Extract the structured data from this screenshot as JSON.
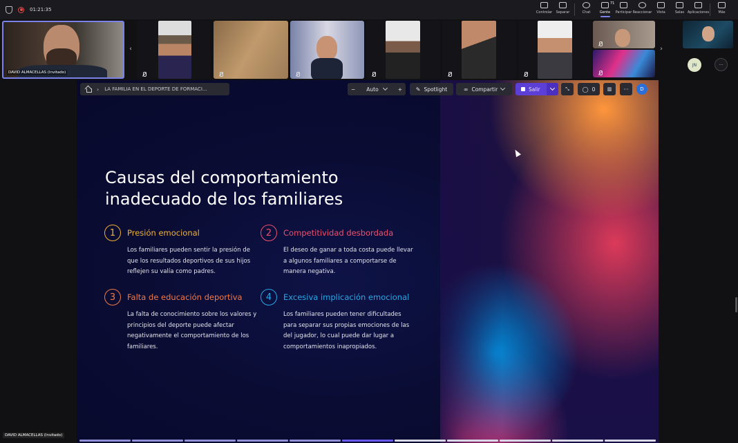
{
  "meeting": {
    "timer": "01:21:35",
    "toolbar": [
      {
        "label": "Controlar",
        "icon": "control-icon"
      },
      {
        "label": "Separar",
        "icon": "popout-icon"
      },
      {
        "label": "Chat",
        "icon": "chat-icon"
      },
      {
        "label": "Gente",
        "icon": "people-icon",
        "count": "71",
        "active": true
      },
      {
        "label": "Participar",
        "icon": "raise-hand-icon"
      },
      {
        "label": "Reaccionar",
        "icon": "smile-icon"
      },
      {
        "label": "Vista",
        "icon": "view-icon"
      },
      {
        "label": "Salas",
        "icon": "rooms-icon"
      },
      {
        "label": "Aplicaciones",
        "icon": "apps-icon"
      },
      {
        "label": "Más",
        "icon": "more-icon"
      }
    ],
    "self_tile_name": "DAVID ALMACELLAS (Invitado)",
    "bottom_name": "DAVID ALMACELLAS (Invitado)",
    "avatar_initials": "JN",
    "accent": "#7b83eb"
  },
  "presentation": {
    "breadcrumb": "LA FAMILIA EN EL DEPORTE DE FORMACI...",
    "zoom_label": "Auto",
    "zoom_minus": "−",
    "zoom_plus": "+",
    "spotlight_label": "Spotlight",
    "share_label": "Compartir",
    "exit_label": "Salir",
    "comment_count": "0",
    "user_initial": "D",
    "slide": {
      "title": "Causas del comportamiento inadecuado de los familiares",
      "items": [
        {
          "num": "1",
          "color": "#f2b233",
          "title": "Presión emocional",
          "desc": "Los familiares pueden sentir la presión de que los resultados deportivos de sus hijos reflejen su valía como padres."
        },
        {
          "num": "2",
          "color": "#ef4f6c",
          "title": "Competitividad desbordada",
          "desc": "El deseo de ganar a toda costa puede llevar a algunos familiares a comportarse de manera negativa."
        },
        {
          "num": "3",
          "color": "#f2794a",
          "title": "Falta de educación deportiva",
          "desc": "La falta de conocimiento sobre los valores y principios del deporte puede afectar negativamente el comportamiento de los familiares."
        },
        {
          "num": "4",
          "color": "#27a8e6",
          "title": "Excesiva implicación emocional",
          "desc": "Los familiares pueden tener dificultades para separar sus propias emociones de las del jugador, lo cual puede dar lugar a comportamientos inapropiados."
        }
      ]
    },
    "progress": {
      "total": 11,
      "current": 6
    }
  }
}
